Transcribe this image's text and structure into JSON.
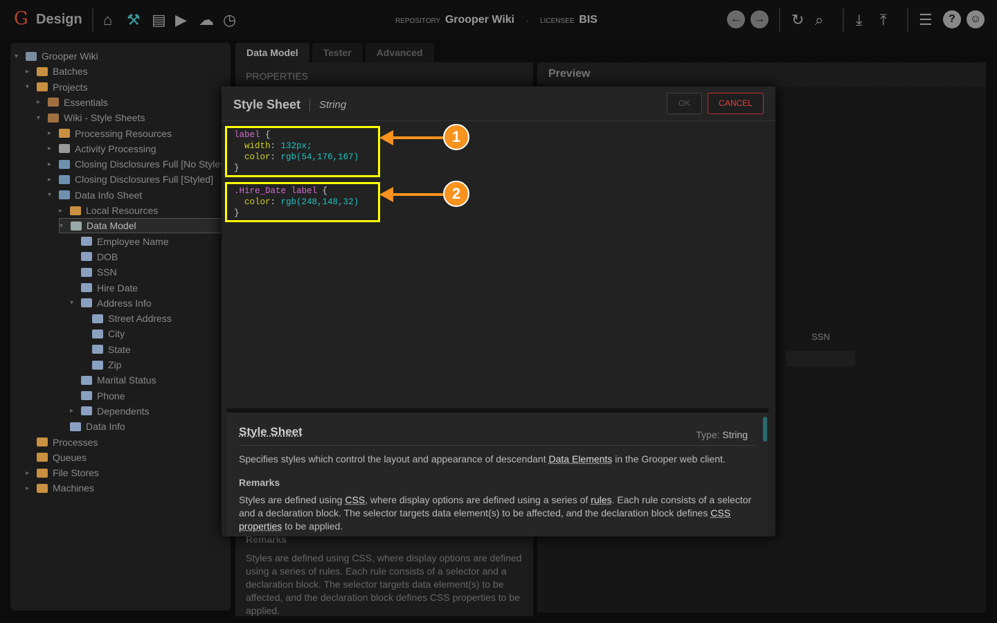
{
  "header": {
    "logo": "G",
    "app": "Design",
    "repo_label": "REPOSITORY",
    "repo": "Grooper Wiki",
    "dot": "·",
    "lic_label": "LICENSEE",
    "lic": "BIS"
  },
  "tree": [
    {
      "t": "▾",
      "label": "Grooper Wiki",
      "lvl": 0,
      "c": "#7a8aa0"
    },
    {
      "t": "▸",
      "label": "Batches",
      "lvl": 1,
      "c": "#c89040"
    },
    {
      "t": "▾",
      "label": "Projects",
      "lvl": 1,
      "c": "#c89040"
    },
    {
      "t": "▸",
      "label": "Essentials",
      "lvl": 2,
      "c": "#a07040"
    },
    {
      "t": "▾",
      "label": "Wiki - Style Sheets",
      "lvl": 2,
      "c": "#a07040"
    },
    {
      "t": "▸",
      "label": "Processing Resources",
      "lvl": 3,
      "c": "#c89040"
    },
    {
      "t": "▸",
      "label": "Activity Processing",
      "lvl": 3,
      "c": "#999"
    },
    {
      "t": "▸",
      "label": "Closing Disclosures Full [No Styles]",
      "lvl": 3,
      "c": "#7090b0"
    },
    {
      "t": "▸",
      "label": "Closing Disclosures Full [Styled]",
      "lvl": 3,
      "c": "#7090b0"
    },
    {
      "t": "▾",
      "label": "Data Info Sheet",
      "lvl": 3,
      "c": "#7090b0"
    },
    {
      "t": "▸",
      "label": "Local Resources",
      "lvl": 4,
      "c": "#c89040"
    },
    {
      "t": "▾",
      "label": "Data Model",
      "lvl": 4,
      "c": "#9aa",
      "sel": true
    },
    {
      "t": "",
      "label": "Employee Name",
      "lvl": 5,
      "c": "#8aa0c0"
    },
    {
      "t": "",
      "label": "DOB",
      "lvl": 5,
      "c": "#8aa0c0"
    },
    {
      "t": "",
      "label": "SSN",
      "lvl": 5,
      "c": "#8aa0c0"
    },
    {
      "t": "",
      "label": "Hire Date",
      "lvl": 5,
      "c": "#8aa0c0"
    },
    {
      "t": "▾",
      "label": "Address Info",
      "lvl": 5,
      "c": "#8aa0c0"
    },
    {
      "t": "",
      "label": "Street Address",
      "lvl": 6,
      "c": "#8aa0c0"
    },
    {
      "t": "",
      "label": "City",
      "lvl": 6,
      "c": "#8aa0c0"
    },
    {
      "t": "",
      "label": "State",
      "lvl": 6,
      "c": "#8aa0c0"
    },
    {
      "t": "",
      "label": "Zip",
      "lvl": 6,
      "c": "#8aa0c0"
    },
    {
      "t": "",
      "label": "Marital Status",
      "lvl": 5,
      "c": "#8aa0c0"
    },
    {
      "t": "",
      "label": "Phone",
      "lvl": 5,
      "c": "#8aa0c0"
    },
    {
      "t": "▸",
      "label": "Dependents",
      "lvl": 5,
      "c": "#8aa0c0"
    },
    {
      "t": "",
      "label": "Data Info",
      "lvl": 4,
      "c": "#8aa0c0"
    },
    {
      "t": "",
      "label": "Processes",
      "lvl": 1,
      "c": "#c89040"
    },
    {
      "t": "",
      "label": "Queues",
      "lvl": 1,
      "c": "#c89040"
    },
    {
      "t": "▸",
      "label": "File Stores",
      "lvl": 1,
      "c": "#c89040"
    },
    {
      "t": "▸",
      "label": "Machines",
      "lvl": 1,
      "c": "#c89040"
    }
  ],
  "tabs": [
    "Data Model",
    "Tester",
    "Advanced"
  ],
  "properties": "PROPERTIES",
  "preview": {
    "title": "Preview",
    "ssn": "SSN"
  },
  "bg_remarks": {
    "title": "Remarks",
    "text": "Styles are defined using CSS, where display options are defined using a series of rules. Each rule consists of a selector and a declaration block. The selector targets data element(s) to be affected, and the declaration block defines CSS properties to be applied."
  },
  "modal": {
    "title": "Style Sheet",
    "type": "String",
    "ok": "OK",
    "cancel": "CANCEL",
    "code1": {
      "sel": "label",
      "open": " {",
      "p1": "width",
      "v1": "132px;",
      "p2": "color",
      "v2": "rgb(54,176,167)",
      "close": "}"
    },
    "code2": {
      "sel": ".Hire_Date label",
      "open": " {",
      "p1": "color",
      "v1": "rgb(248,148,32)",
      "close": "}"
    },
    "badges": [
      "1",
      "2"
    ]
  },
  "help": {
    "title": "Style Sheet",
    "type_label": "Type:",
    "type": "String",
    "desc1": "Specifies styles which control the layout and appearance of descendant ",
    "desc_link": "Data Elements",
    "desc2": " in the Grooper web client.",
    "remarks": "Remarks",
    "r1": "Styles are defined using ",
    "r_css": "CSS",
    "r2": ", where display options are defined using a series of ",
    "r_rules": "rules",
    "r3": ". Each rule consists of a selector and a declaration block. The selector targets data element(s) to be affected, and the declaration block defines ",
    "r_props": "CSS properties",
    "r4": " to be applied."
  }
}
